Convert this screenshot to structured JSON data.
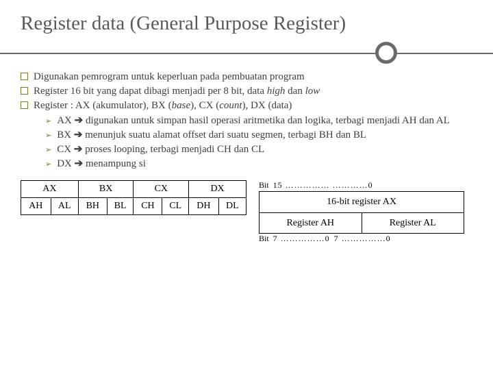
{
  "title": "Register data (General Purpose Register)",
  "bullets": [
    {
      "text": "Digunakan pemrogram untuk keperluan pada pembuatan program"
    },
    {
      "pre": "Register 16 bit yang dapat dibagi menjadi per 8 bit, data ",
      "it1": "high",
      "mid": " dan ",
      "it2": "low"
    },
    {
      "pre": "Register : AX (akumulator), BX (",
      "it1": "base",
      "mid1": "), CX (",
      "it2": "count",
      "post": "), DX (data)"
    }
  ],
  "subs": [
    {
      "head": "AX",
      "arrow": "➔",
      "tail": " digunakan untuk simpan hasil operasi aritmetika dan logika, terbagi menjadi AH dan AL"
    },
    {
      "head": "BX",
      "arrow": "➔",
      "tail": " menunjuk suatu alamat offset dari suatu segmen, terbagi BH dan BL"
    },
    {
      "head": "CX",
      "arrow": "➔",
      "tail": " proses looping, terbagi menjadi CH dan CL"
    },
    {
      "head": "DX",
      "arrow": "➔",
      "tail": " menampung si"
    }
  ],
  "tableLeft": {
    "header": [
      "AX",
      "BX",
      "CX",
      "DX"
    ],
    "sub": [
      "AH",
      "AL",
      "BH",
      "BL",
      "CH",
      "CL",
      "DH",
      "DL"
    ]
  },
  "figRight": {
    "bitTopLeft": "Bit",
    "bitTopNums": "15 …………… …………0",
    "regTitle": "16-bit register AX",
    "regAH": "Register AH",
    "regAL": "Register AL",
    "bitBotLeft": "Bit",
    "bitBot1": "7 ……………0",
    "bitBot2": "7 ……………0"
  }
}
